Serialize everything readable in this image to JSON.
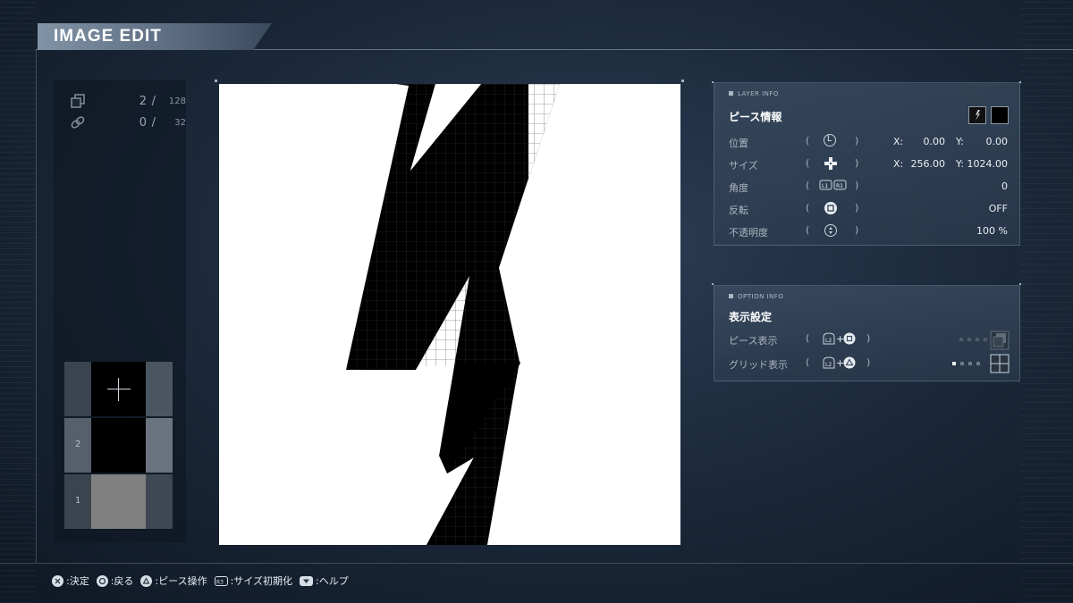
{
  "title": "IMAGE EDIT",
  "counters": {
    "pieces": {
      "current": "2",
      "max": "128",
      "icon": "pieces-icon"
    },
    "links": {
      "current": "0",
      "max": "32",
      "icon": "link-icon"
    }
  },
  "layers": [
    {
      "label": "",
      "fill": "#000000",
      "type": "add"
    },
    {
      "label": "2",
      "fill": "#000000",
      "type": "layer"
    },
    {
      "label": "1",
      "fill": "#808080",
      "type": "layer"
    }
  ],
  "layer_info": {
    "tag": "LAYER INFO",
    "title": "ピース情報",
    "rows": [
      {
        "label": "位置",
        "button": "L-stick",
        "x_label": "X:",
        "x_value": "0.00",
        "y_label": "Y:",
        "y_value": "0.00"
      },
      {
        "label": "サイズ",
        "button": "d-pad",
        "x_label": "X:",
        "x_value": "256.00",
        "y_label": "Y:",
        "y_value": "1024.00"
      },
      {
        "label": "角度",
        "button": "L1-R1",
        "value": "0"
      },
      {
        "label": "反転",
        "button": "square",
        "value": "OFF"
      },
      {
        "label": "不透明度",
        "button": "R-stick",
        "value": "100 %"
      }
    ]
  },
  "option_info": {
    "tag": "OPTION INFO",
    "title": "表示設定",
    "rows": [
      {
        "label": "ピース表示",
        "button": "L2+square"
      },
      {
        "label": "グリッド表示",
        "button": "L2+triangle"
      }
    ]
  },
  "footer": [
    {
      "button": "cross",
      "label": ":決定"
    },
    {
      "button": "circle",
      "label": ":戻る"
    },
    {
      "button": "triangle",
      "label": ":ピース操作"
    },
    {
      "button": "R3",
      "label": ":サイズ初期化"
    },
    {
      "button": "touchpad",
      "label": ":ヘルプ"
    }
  ],
  "colors": {
    "accent": "#8193a6",
    "canvas": "#ffffff",
    "shape": "#000000"
  }
}
